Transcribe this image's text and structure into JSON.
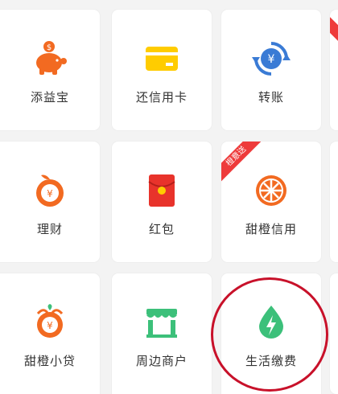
{
  "grid": {
    "row1": {
      "tile1_label": "添益宝",
      "tile2_label": "还信用卡",
      "tile3_label": "转账"
    },
    "row2": {
      "tile1_label": "理财",
      "tile2_label": "红包",
      "tile3_label": "甜橙信用",
      "tile3_badge": "橙意送"
    },
    "row3": {
      "tile1_label": "甜橙小贷",
      "tile2_label": "周边商户",
      "tile3_label": "生活缴费"
    }
  },
  "colors": {
    "orange": "#f26a21",
    "yellow": "#ffcc00",
    "blue": "#3a7bd5",
    "red": "#e8332b",
    "green": "#3cc07a",
    "badge_red": "#ee3b3b",
    "highlight_circle": "#c8112a"
  },
  "icons": {
    "row1": [
      "piggy-bank-icon",
      "credit-card-icon",
      "transfer-yuan-icon"
    ],
    "row2": [
      "coin-yuan-icon",
      "red-envelope-icon",
      "orange-slice-icon"
    ],
    "row3": [
      "loan-orange-bag-icon",
      "shop-storefront-icon",
      "water-drop-bolt-icon"
    ]
  }
}
